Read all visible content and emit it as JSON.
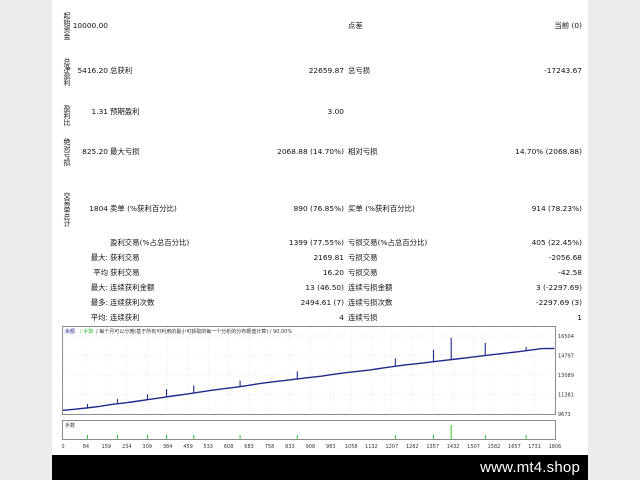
{
  "labels": {
    "initial_deposit": "起始资金",
    "total_net_profit": "总净盈利",
    "profit_factor": "盈利比",
    "absolute_drawdown": "绝对亏损",
    "total_trades": "交易单总计"
  },
  "rows": {
    "r1": {
      "v1": "10000.00",
      "l2": "点差",
      "l3": "当前 (0)"
    },
    "r2": {
      "v1": "5416.20",
      "l2": "总获利",
      "v2": "22659.87",
      "l3": "总亏损",
      "v3": "-17243.67"
    },
    "r3": {
      "v1": "1.31",
      "l2": "预期盈利",
      "v2": "3.00"
    },
    "r4": {
      "v1": "825.20",
      "l2": "最大亏损",
      "v2": "2068.88 (14.70%)",
      "l3": "相对亏损",
      "v3": "14.70% (2068.88)"
    },
    "r5": {
      "v1": "1804",
      "l2": "卖单 (%获利百分比)",
      "v2": "890 (76.85%)",
      "l3": "买单 (%获利百分比)",
      "v3": "914 (78.23%)"
    },
    "r6": {
      "l2": "盈利交易(%占总百分比)",
      "v2": "1399 (77.55%)",
      "l3": "亏损交易(%占总百分比)",
      "v3": "405 (22.45%)"
    },
    "r7": {
      "p": "最大:",
      "l2": "获利交易",
      "v2": "2169.81",
      "l3": "亏损交易",
      "v3": "-2056.68"
    },
    "r8": {
      "p": "平均",
      "l2": "获利交易",
      "v2": "16.20",
      "l3": "亏损交易",
      "v3": "-42.58"
    },
    "r9": {
      "p": "最大:",
      "l2": "连续获利金额",
      "v2": "13 (46.50)",
      "l3": "连续亏损金额",
      "v3": "3 (-2297.69)"
    },
    "r10": {
      "p": "最多:",
      "l2": "连续获利次数",
      "v2": "2494.61 (7)",
      "l3": "连续亏损次数",
      "v3": "-2297.69 (3)"
    },
    "r11": {
      "p": "平均:",
      "l2": "连续获利",
      "v2": "4",
      "l3": "连续亏损",
      "v3": "1"
    }
  },
  "chart": {
    "header_a": "余额",
    "header_b": "/ 手数",
    "header_c": "/ 每个月可以分摊(基于所有可利用的最小可获取的每一个分析的分布概值计算) / 90.00%",
    "volume_label": "手数",
    "colors": {
      "balance": "#1f2a8c",
      "volume": "#2fbf2f",
      "grid": "#c9c9c9",
      "border": "#8a8a8a"
    }
  },
  "chart_data": {
    "type": "line",
    "series": [
      {
        "values": [
          10000,
          10090,
          10210,
          10350,
          10520,
          10640,
          10790,
          10950,
          11100,
          11260,
          11410,
          11570,
          11740,
          11880,
          12010,
          12160,
          12340,
          12480,
          12600,
          12730,
          12860,
          12980,
          13150,
          13290,
          13410,
          13530,
          13700,
          13850,
          13990,
          14100,
          14230,
          14360,
          14490,
          14620,
          14750,
          14880,
          15000,
          15120,
          15260,
          15400,
          15416
        ]
      }
    ],
    "x": [
      0,
      45,
      90,
      136,
      181,
      226,
      271,
      316,
      361,
      406,
      451,
      497,
      542,
      587,
      632,
      677,
      722,
      767,
      812,
      857,
      902,
      948,
      993,
      1038,
      1083,
      1128,
      1173,
      1218,
      1263,
      1308,
      1353,
      1399,
      1444,
      1489,
      1534,
      1579,
      1624,
      1669,
      1714,
      1759,
      1804
    ],
    "spikes": [
      {
        "x": 90,
        "y": 10560
      },
      {
        "x": 200,
        "y": 10990
      },
      {
        "x": 310,
        "y": 11400
      },
      {
        "x": 380,
        "y": 11850
      },
      {
        "x": 480,
        "y": 12180
      },
      {
        "x": 650,
        "y": 12600
      },
      {
        "x": 860,
        "y": 13400
      },
      {
        "x": 1220,
        "y": 14550
      },
      {
        "x": 1360,
        "y": 15300
      },
      {
        "x": 1425,
        "y": 16350
      },
      {
        "x": 1550,
        "y": 15900
      },
      {
        "x": 1700,
        "y": 15550
      }
    ],
    "volume_bars": [
      90,
      200,
      310,
      380,
      480,
      650,
      860,
      1220,
      1360,
      1425,
      1550,
      1700
    ],
    "y_ticks": [
      "16504",
      "14797",
      "13089",
      "11381",
      "9673"
    ],
    "x_ticks": [
      "0",
      "84",
      "159",
      "234",
      "309",
      "384",
      "459",
      "533",
      "608",
      "683",
      "758",
      "833",
      "908",
      "983",
      "1058",
      "1132",
      "1207",
      "1282",
      "1357",
      "1432",
      "1507",
      "1582",
      "1657",
      "1731",
      "1806"
    ],
    "ylim": [
      9673,
      16504
    ],
    "xlim": [
      0,
      1806
    ]
  },
  "footer": {
    "brand": "www.mt4.shop"
  }
}
